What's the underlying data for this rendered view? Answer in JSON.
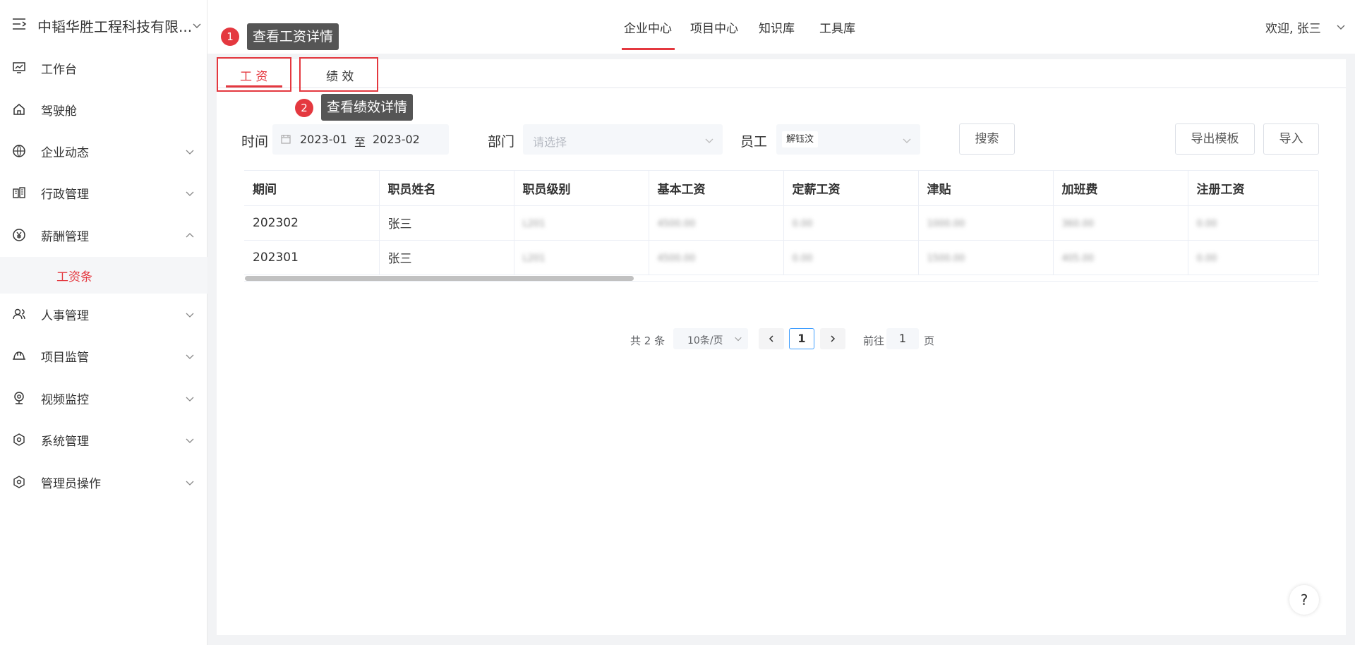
{
  "brand": {
    "name": "中韬华胜工程科技有限..."
  },
  "sidebar": {
    "items": [
      {
        "label": "工作台",
        "icon": "monitor-chart-icon"
      },
      {
        "label": "驾驶舱",
        "icon": "home-icon"
      },
      {
        "label": "企业动态",
        "icon": "globe-icon"
      },
      {
        "label": "行政管理",
        "icon": "building-icon"
      },
      {
        "label": "薪酬管理",
        "icon": "yen-icon"
      },
      {
        "label": "人事管理",
        "icon": "users-icon"
      },
      {
        "label": "项目监管",
        "icon": "helmet-icon"
      },
      {
        "label": "视频监控",
        "icon": "camera-icon"
      },
      {
        "label": "系统管理",
        "icon": "settings-icon"
      },
      {
        "label": "管理员操作",
        "icon": "settings-icon"
      }
    ],
    "sub_item": "工资条"
  },
  "header": {
    "tabs": [
      "企业中心",
      "项目中心",
      "知识库",
      "工具库"
    ],
    "active_tab": "企业中心",
    "welcome": "欢迎, 张三"
  },
  "content_tabs": {
    "salary": "工 资",
    "performance": "绩 效"
  },
  "tooltips": {
    "one": {
      "num": "1",
      "text": "查看工资详情"
    },
    "two": {
      "num": "2",
      "text": "查看绩效详情"
    }
  },
  "filters": {
    "time_label": "时间",
    "date_start": "2023-01",
    "date_sep": "至",
    "date_end": "2023-02",
    "dept_label": "部门",
    "dept_placeholder": "请选择",
    "employee_label": "员工",
    "employee_value": "解钰汶",
    "search_button": "搜索",
    "export_button": "导出模板",
    "import_button": "导入"
  },
  "table": {
    "headers": [
      "期间",
      "职员姓名",
      "职员级别",
      "基本工资",
      "定薪工资",
      "津贴",
      "加班费",
      "注册工资"
    ],
    "rows": [
      [
        "202302",
        "张三",
        "L201",
        "4500.00",
        "0.00",
        "1000.00",
        "360.00",
        "0.00"
      ],
      [
        "202301",
        "张三",
        "L201",
        "4500.00",
        "0.00",
        "1500.00",
        "405.00",
        "0.00"
      ]
    ]
  },
  "pagination": {
    "total": "共 2 条",
    "page_size": "10条/页",
    "current": "1",
    "goto_label": "前往",
    "goto_value": "1",
    "page_suffix": "页"
  },
  "help": "?",
  "colors": {
    "accent": "#e4383f",
    "top_line": "#a77be0"
  }
}
